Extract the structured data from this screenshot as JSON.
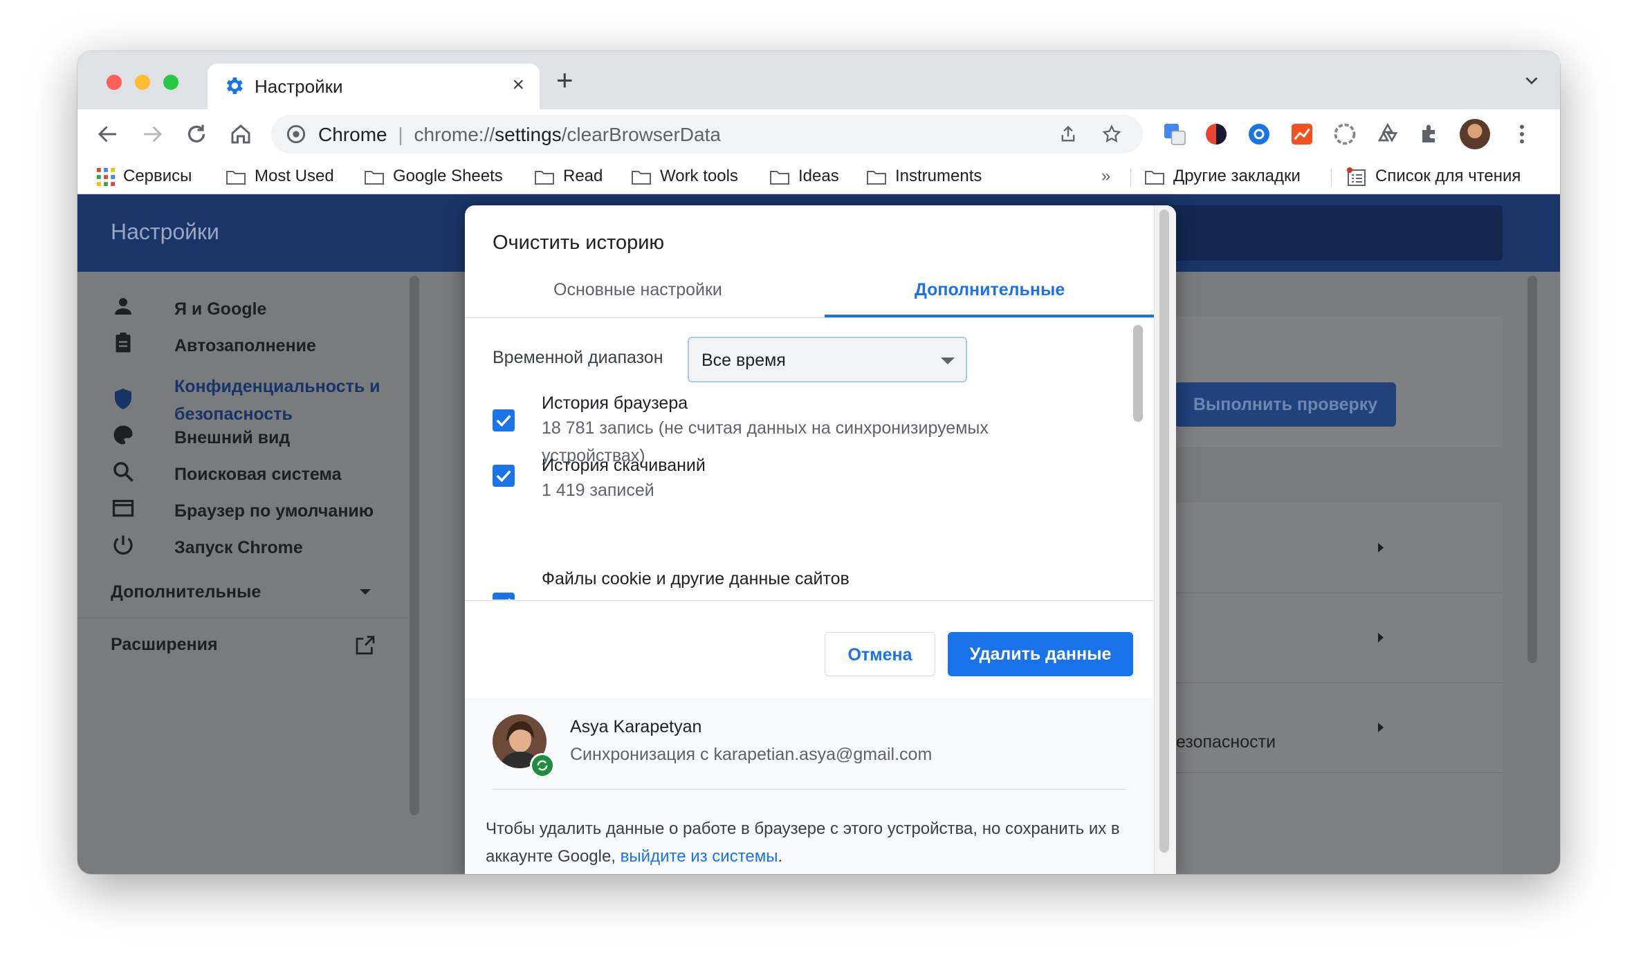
{
  "browser": {
    "tab_title": "Настройки",
    "close_symbol": "×",
    "new_tab_symbol": "+",
    "omnibox": {
      "chip": "Chrome",
      "url_prefix": "chrome://",
      "url_host": "settings",
      "url_path": "/clearBrowserData"
    }
  },
  "bookmarks": {
    "items": [
      "Сервисы",
      "Most Used",
      "Google Sheets",
      "Read",
      "Work tools",
      "Ideas",
      "Instruments"
    ],
    "overflow": "»",
    "other": "Другие закладки",
    "reading_list": "Список для чтения"
  },
  "settings": {
    "title": "Настройки",
    "sidebar": [
      "Я и Google",
      "Автозаполнение",
      "Конфиденциальность и безопасность",
      "Внешний вид",
      "Поисковая система",
      "Браузер по умолчанию",
      "Запуск Chrome"
    ],
    "advanced": "Дополнительные",
    "extensions": "Расширения",
    "run_check": "Выполнить проверку",
    "partial_row": "безопасности"
  },
  "dialog": {
    "title": "Очистить историю",
    "tabs": {
      "basic": "Основные настройки",
      "advanced": "Дополнительные"
    },
    "range_label": "Временной диапазон",
    "range_value": "Все время",
    "items": [
      {
        "title": "История браузера",
        "desc": "18 781 запись (не считая данных на синхронизируемых устройствах)",
        "checked": true
      },
      {
        "title": "История скачиваний",
        "desc": "1 419 записей",
        "checked": true
      },
      {
        "title": "Файлы cookie и другие данные сайтов",
        "desc": "",
        "checked": true
      }
    ],
    "cancel": "Отмена",
    "delete": "Удалить данные",
    "user_name": "Asya Karapetyan",
    "sync_text": "Синхронизация с karapetian.asya@gmail.com",
    "note_text": "Чтобы удалить данные о работе в браузере с этого устройства, но сохранить их в аккаунте Google, ",
    "note_link": "выйдите из системы",
    "note_end": "."
  },
  "colors": {
    "accent": "#1a73e8",
    "header": "#1b3569",
    "sync_badge": "#1e8e3e"
  }
}
